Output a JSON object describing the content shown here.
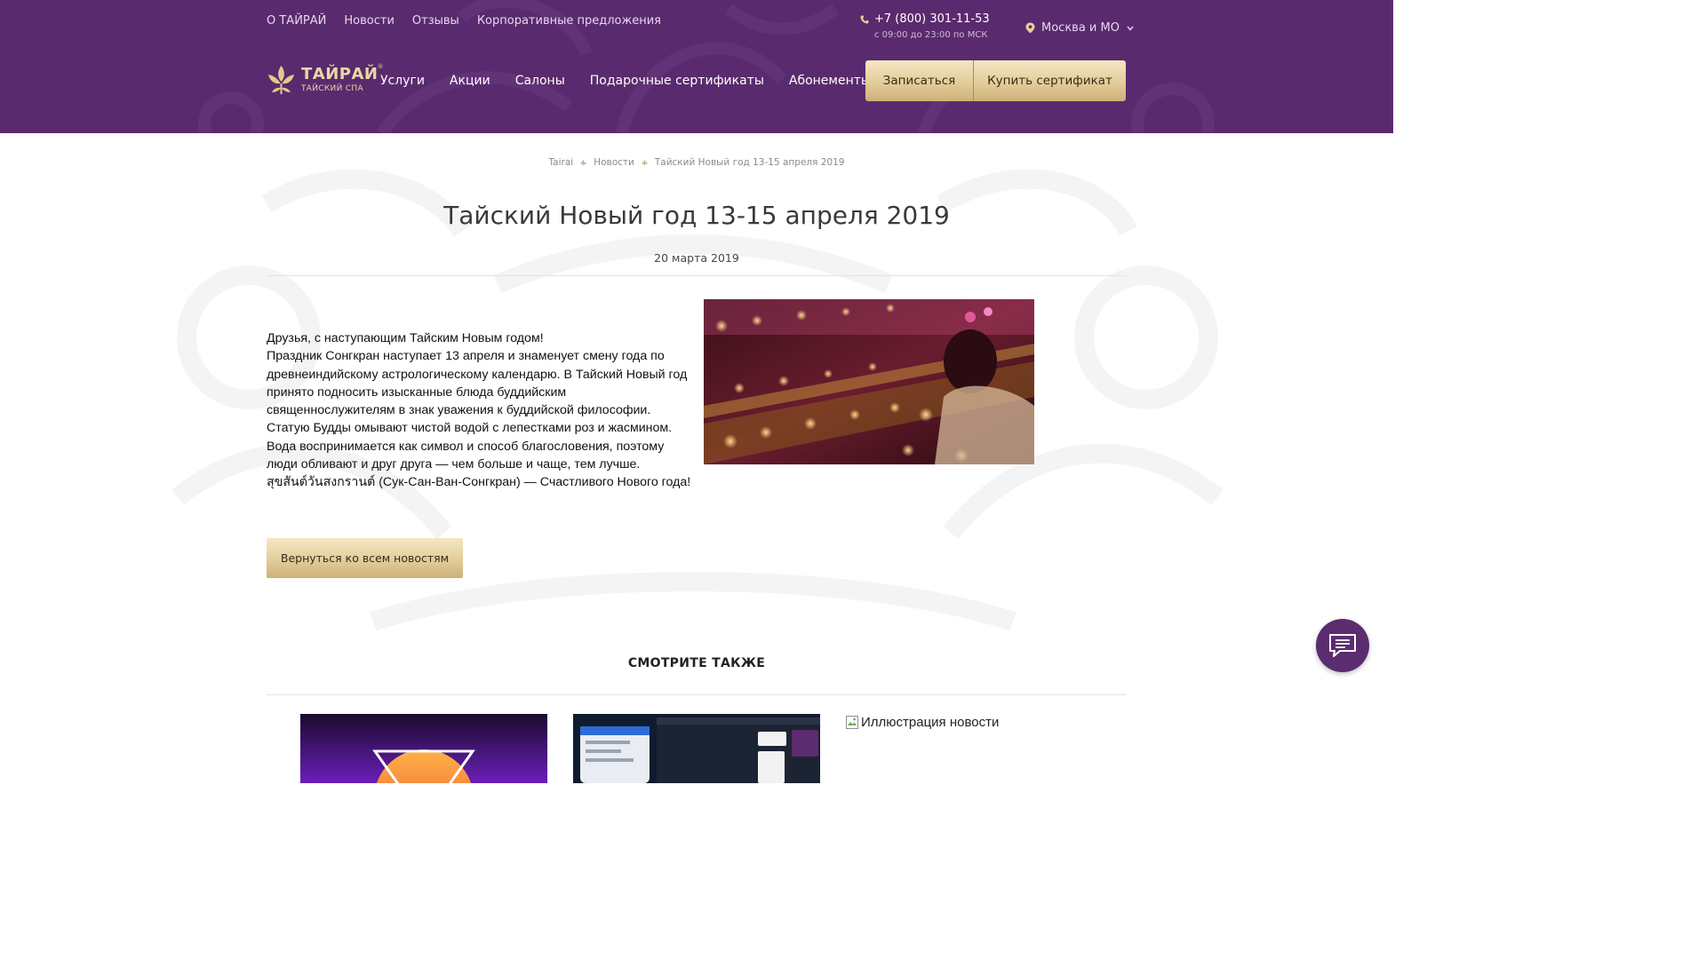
{
  "top_nav": [
    "О ТАЙРАЙ",
    "Новости",
    "Отзывы",
    "Корпоративные предложения"
  ],
  "contact": {
    "phone": "+7 (800) 301-11-53",
    "hours": "с 09:00 до 23:00 по МСК",
    "phone_icon": "phone-icon"
  },
  "city": {
    "label": "Москва и МО",
    "icon": "map-pin-icon"
  },
  "logo": {
    "name": "ТАЙРАЙ",
    "registered": "®",
    "tagline": "ТАЙСКИЙ СПА"
  },
  "main_nav": [
    "Услуги",
    "Акции",
    "Салоны",
    "Подарочные сертификаты",
    "Абонементы"
  ],
  "header_buttons": {
    "signup": "Записаться",
    "buy_certificate": "Купить сертификат"
  },
  "breadcrumb": [
    "Tairai",
    "Новости",
    "Тайский Новый год 13-15 апреля 2019"
  ],
  "article": {
    "title": "Тайский Новый год 13-15 апреля 2019",
    "date": "20 марта 2019",
    "paragraphs": [
      "Друзья, с наступающим Тайским Новым годом!",
      "Праздник Сонгкран наступает 13 апреля и знаменует смену года по древнеиндийскому астрологическому календарю. В Тайский Новый год принято подносить изысканные блюда буддийским священнослужителям в знак уважения к буддийской философии. Статую Будды омывают чистой водой с лепестками роз и жасмином. Вода воспринимается как символ и способ благословения, поэтому люди обливают и друг друга — чем больше и чаще, тем лучше.",
      "สุขสันต์วันสงกรานต์ (Сук-Сан-Ван-Сонгкран) — Счастливого Нового года!"
    ]
  },
  "back_button": "Вернуться ко всем новостям",
  "see_also": {
    "heading": "СМОТРИТЕ ТАКЖЕ",
    "broken_image_alt": "Иллюстрация новости"
  },
  "colors": {
    "header_bg": "#5a2a6e",
    "gold_button": "#e3cd99",
    "chat_button": "#5b2c6f"
  },
  "icons": [
    "phone-icon",
    "map-pin-icon",
    "chevron-down-icon",
    "lotus-logo-icon",
    "breadcrumb-separator-icon",
    "broken-image-icon",
    "chat-icon"
  ]
}
